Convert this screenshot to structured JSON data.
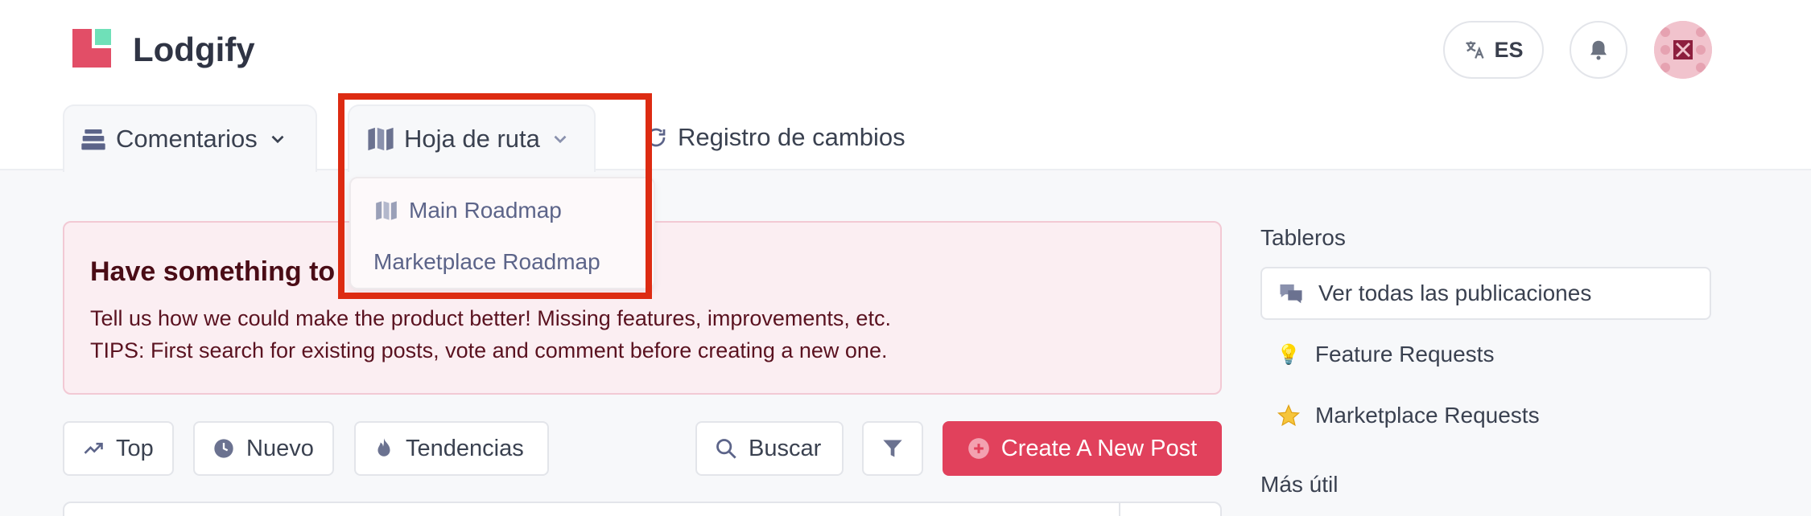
{
  "header": {
    "brand": "Lodgify",
    "language": "ES"
  },
  "tabs": {
    "comments": "Comentarios",
    "roadmap": "Hoja de ruta",
    "changelog": "Registro de cambios"
  },
  "roadmap_menu": {
    "items": [
      "Main Roadmap",
      "Marketplace Roadmap"
    ]
  },
  "banner": {
    "title": "Have something to",
    "line1": "Tell us how we could make the product better! Missing features, improvements, etc.",
    "line2": "TIPS: First search for existing posts, vote and comment before creating a new one."
  },
  "sort": {
    "top": "Top",
    "new": "Nuevo",
    "trending": "Tendencias"
  },
  "actions": {
    "search": "Buscar",
    "create": "Create A New Post"
  },
  "sidebar": {
    "boards_heading": "Tableros",
    "boards": [
      {
        "label": "Ver todas las publicaciones",
        "icon": "comments-icon"
      },
      {
        "label": "Feature Requests",
        "icon": "lightbulb-icon"
      },
      {
        "label": "Marketplace Requests",
        "icon": "star-icon"
      }
    ],
    "most_useful_heading": "Más útil"
  },
  "colors": {
    "brand_red": "#e24e67",
    "brand_mint": "#6fe0b8",
    "create_button": "#e1415c",
    "highlight_box": "#dd2b12"
  }
}
